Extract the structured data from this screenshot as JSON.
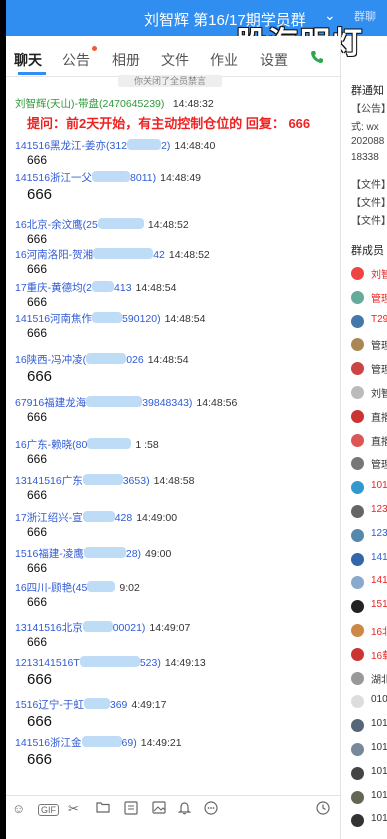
{
  "window": {
    "title": "刘智辉 第16/17期学员群",
    "chevron": "⌄",
    "pinned_text": "群聊"
  },
  "watermark": "股海明灯",
  "tabs": [
    "聊天",
    "公告",
    "相册",
    "文件",
    "作业",
    "设置"
  ],
  "system_message": "你关闭了全员禁言",
  "messages": [
    {
      "sender": "刘智辉(天山)-带盘(2470645239)",
      "time": "14:48:32",
      "content": "提问：前2天开始，有主动控制仓位的 回复：  666",
      "owner": true
    },
    {
      "sender_pre": "141516黑龙江-姜亦",
      "sender_mid": "(312",
      "sender_post": "2)",
      "time": "14:48:40",
      "content": "666",
      "big": false
    },
    {
      "sender_pre": "141516浙江一父",
      "sender_mid": "",
      "sender_post": "8011)",
      "time": "14:48:49",
      "content": "666",
      "big": true
    },
    {
      "sender_pre": "16北京-余汶鹰(25",
      "sender_mid": "",
      "sender_post": "",
      "time": "14:48:52",
      "content": "666",
      "big": false
    },
    {
      "sender_pre": "16河南洛阳-贺湘",
      "sender_mid": "",
      "sender_post": "42",
      "time": "14:48:52",
      "content": "666",
      "big": false
    },
    {
      "sender_pre": "17重庆-黄德均(2",
      "sender_mid": "",
      "sender_post": "413",
      "time": "14:48:54",
      "content": "666",
      "big": false
    },
    {
      "sender_pre": "141516河南焦作",
      "sender_mid": "",
      "sender_post": "590120)",
      "time": "14:48:54",
      "content": "666",
      "big": false
    },
    {
      "sender_pre": "16陕西-冯冲凌(",
      "sender_mid": "",
      "sender_post": "026",
      "time": "14:48:54",
      "content": "666",
      "big": true
    },
    {
      "sender_pre": "67916福建龙海",
      "sender_mid": "",
      "sender_post": "39848343)",
      "time": "14:48:56",
      "content": "666",
      "big": false
    },
    {
      "sender_pre": "16广东-赖晓(80",
      "sender_mid": "",
      "sender_post": "",
      "time": "1 :58",
      "content": "666",
      "big": false
    },
    {
      "sender_pre": "13141516广东",
      "sender_mid": "",
      "sender_post": "3653)",
      "time": "14:48:58",
      "content": "666",
      "big": false
    },
    {
      "sender_pre": "17浙江绍兴-宣",
      "sender_mid": "",
      "sender_post": "428",
      "time": "14:49:00",
      "content": "666",
      "big": false
    },
    {
      "sender_pre": "1516福建-凌鹰",
      "sender_mid": "",
      "sender_post": "28)",
      "time": "49:00",
      "content": "666",
      "big": false
    },
    {
      "sender_pre": "16四川-顾艳(45",
      "sender_mid": "",
      "sender_post": "",
      "time": "9:02",
      "content": "666",
      "big": false
    },
    {
      "sender_pre": "13141516北京",
      "sender_mid": "",
      "sender_post": "00021)",
      "time": "14:49:07",
      "content": "666",
      "big": false
    },
    {
      "sender_pre": "1213141516T",
      "sender_mid": "",
      "sender_post": "523)",
      "time": "14:49:13",
      "content": "666",
      "big": true
    },
    {
      "sender_pre": "1516辽宁-于虹",
      "sender_mid": "",
      "sender_post": "369",
      "time": "4:49:17",
      "content": "666",
      "big": true
    },
    {
      "sender_pre": "141516浙江金",
      "sender_mid": "",
      "sender_post": "69)",
      "time": "14:49:21",
      "content": "666",
      "big": true
    }
  ],
  "right_panel": {
    "notice_title": "群通知",
    "notice_lines": [
      "【公告】",
      "式: wx",
      "202088",
      "18338"
    ],
    "files": [
      "【文件】",
      "【文件】",
      "【文件】"
    ],
    "members_title": "群成员",
    "members": [
      {
        "name": "刘智",
        "color": "#e22",
        "av": "#e44"
      },
      {
        "name": "管理",
        "color": "#e22",
        "av": "#6a9"
      },
      {
        "name": "T29",
        "color": "#e22",
        "av": "#47a"
      },
      {
        "name": "管理",
        "color": "#333",
        "av": "#a85"
      },
      {
        "name": "管理",
        "color": "#333",
        "av": "#c44"
      },
      {
        "name": "刘智",
        "color": "#333",
        "av": "#bbb"
      },
      {
        "name": "直播",
        "color": "#333",
        "av": "#c33"
      },
      {
        "name": "直播",
        "color": "#333",
        "av": "#d55"
      },
      {
        "name": "管理",
        "color": "#333",
        "av": "#777"
      },
      {
        "name": "101",
        "color": "#e22",
        "av": "#39c"
      },
      {
        "name": "123",
        "color": "#e22",
        "av": "#666"
      },
      {
        "name": "123",
        "color": "#2f5bd6",
        "av": "#58a"
      },
      {
        "name": "141",
        "color": "#2f5bd6",
        "av": "#36a"
      },
      {
        "name": "141",
        "color": "#e22",
        "av": "#8ac"
      },
      {
        "name": "151",
        "color": "#e22",
        "av": "#222"
      },
      {
        "name": "16北",
        "color": "#e22",
        "av": "#c84"
      },
      {
        "name": "16载",
        "color": "#e22",
        "av": "#c33"
      },
      {
        "name": "湖北",
        "color": "#333",
        "av": "#999"
      },
      {
        "name": "010",
        "color": "#333",
        "av": "#ddd"
      },
      {
        "name": "101",
        "color": "#333",
        "av": "#567"
      },
      {
        "name": "101",
        "color": "#333",
        "av": "#789"
      },
      {
        "name": "101",
        "color": "#333",
        "av": "#444"
      },
      {
        "name": "101",
        "color": "#333",
        "av": "#665"
      },
      {
        "name": "101",
        "color": "#333",
        "av": "#333"
      }
    ]
  },
  "toolbar_icons": [
    "emoji-icon",
    "gif-icon",
    "scissors-icon",
    "folder-icon",
    "image-text-icon",
    "image-icon",
    "bell-icon",
    "more-icon",
    "history-icon"
  ]
}
